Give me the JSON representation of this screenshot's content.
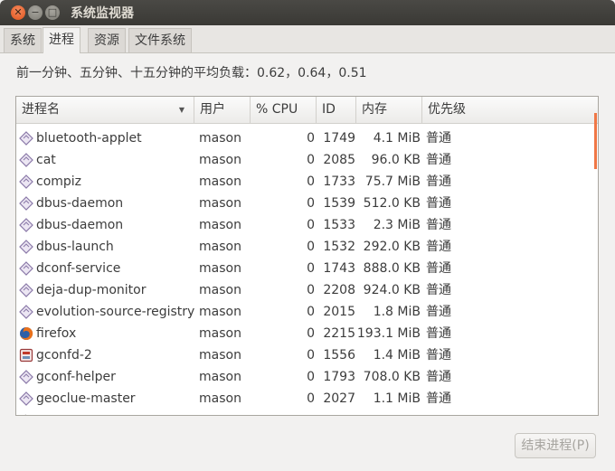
{
  "window": {
    "title": "系统监视器",
    "close_glyph": "✕",
    "minimize_glyph": "−",
    "maximize_glyph": "□"
  },
  "tabs": [
    {
      "label": "系统"
    },
    {
      "label": "进程",
      "active": true
    },
    {
      "label": "资源"
    },
    {
      "label": "文件系统"
    }
  ],
  "load_average": "前一分钟、五分钟、十五分钟的平均负载：0.62，0.64，0.51",
  "columns": {
    "name": "进程名",
    "user": "用户",
    "cpu": "% CPU",
    "id": "ID",
    "memory": "内存",
    "priority": "优先级"
  },
  "processes": [
    {
      "name": "bluetooth-applet",
      "user": "mason",
      "cpu": "0",
      "id": "1749",
      "memory": "4.1 MiB",
      "priority": "普通",
      "icon": "diamond-icon"
    },
    {
      "name": "cat",
      "user": "mason",
      "cpu": "0",
      "id": "2085",
      "memory": "96.0 KB",
      "priority": "普通",
      "icon": "diamond-icon"
    },
    {
      "name": "compiz",
      "user": "mason",
      "cpu": "0",
      "id": "1733",
      "memory": "75.7 MiB",
      "priority": "普通",
      "icon": "diamond-icon"
    },
    {
      "name": "dbus-daemon",
      "user": "mason",
      "cpu": "0",
      "id": "1539",
      "memory": "512.0 KB",
      "priority": "普通",
      "icon": "diamond-icon"
    },
    {
      "name": "dbus-daemon",
      "user": "mason",
      "cpu": "0",
      "id": "1533",
      "memory": "2.3 MiB",
      "priority": "普通",
      "icon": "diamond-icon"
    },
    {
      "name": "dbus-launch",
      "user": "mason",
      "cpu": "0",
      "id": "1532",
      "memory": "292.0 KB",
      "priority": "普通",
      "icon": "diamond-icon"
    },
    {
      "name": "dconf-service",
      "user": "mason",
      "cpu": "0",
      "id": "1743",
      "memory": "888.0 KB",
      "priority": "普通",
      "icon": "diamond-icon"
    },
    {
      "name": "deja-dup-monitor",
      "user": "mason",
      "cpu": "0",
      "id": "2208",
      "memory": "924.0 KB",
      "priority": "普通",
      "icon": "diamond-icon"
    },
    {
      "name": "evolution-source-registry",
      "user": "mason",
      "cpu": "0",
      "id": "2015",
      "memory": "1.8 MiB",
      "priority": "普通",
      "icon": "diamond-icon"
    },
    {
      "name": "firefox",
      "user": "mason",
      "cpu": "0",
      "id": "2215",
      "memory": "193.1 MiB",
      "priority": "普通",
      "icon": "firefox-icon"
    },
    {
      "name": "gconfd-2",
      "user": "mason",
      "cpu": "0",
      "id": "1556",
      "memory": "1.4 MiB",
      "priority": "普通",
      "icon": "gconf-icon"
    },
    {
      "name": "gconf-helper",
      "user": "mason",
      "cpu": "0",
      "id": "1793",
      "memory": "708.0 KB",
      "priority": "普通",
      "icon": "diamond-icon"
    },
    {
      "name": "geoclue-master",
      "user": "mason",
      "cpu": "0",
      "id": "2027",
      "memory": "1.1 MiB",
      "priority": "普通",
      "icon": "diamond-icon"
    }
  ],
  "end_process_button": "结束进程(P)",
  "colors": {
    "accent_scroll": "#f07746",
    "titlebar": "#3c3b37"
  }
}
